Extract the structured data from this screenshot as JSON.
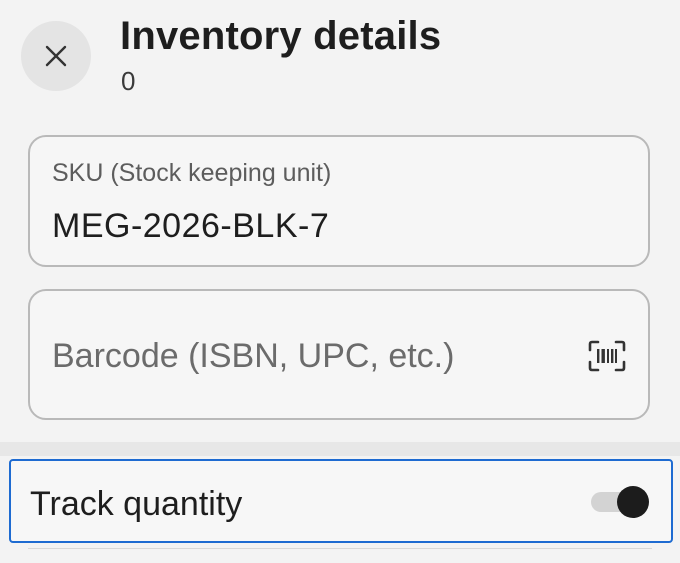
{
  "header": {
    "close_icon": "close-icon",
    "title": "Inventory details",
    "subtitle": "0"
  },
  "sku": {
    "label": "SKU (Stock keeping unit)",
    "value": "MEG-2026-BLK-7"
  },
  "barcode": {
    "placeholder": "Barcode (ISBN, UPC, etc.)",
    "value": "",
    "scan_icon": "barcode-scan-icon"
  },
  "track_quantity": {
    "label": "Track quantity",
    "enabled": true
  },
  "colors": {
    "focus_border": "#1e6bd1",
    "toggle_on": "#1c1c1c",
    "background": "#f3f3f3"
  }
}
